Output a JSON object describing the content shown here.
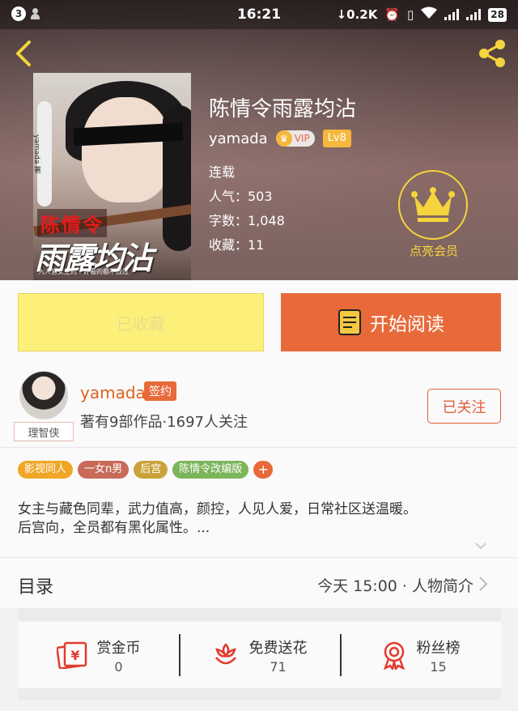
{
  "statusbar": {
    "badge": "3",
    "time": "16:21",
    "speed": "0.2K",
    "battery": "28"
  },
  "book": {
    "title": "陈情令雨露均沾",
    "author": "yamada",
    "vip": "VIP",
    "level": "Lv8",
    "status": "连载",
    "popularity": "人气：503",
    "words": "字数：1,048",
    "favorites": "收藏：11",
    "cover_title_line1": "陈情令",
    "cover_title_line2": "雨露均沾",
    "cover_author": "yamada",
    "cover_tag": "著",
    "cover_subtitle": "入人皆女主的｜好看的都不放过"
  },
  "member": {
    "label": "点亮会员"
  },
  "actions": {
    "collected_label": "已收藏",
    "read_label": "开始阅读"
  },
  "writer": {
    "name": "yamada",
    "sign_badge": "签约",
    "stats": "著有9部作品·1697人关注",
    "avatar_badge": "理智侠",
    "follow_label": "已关注"
  },
  "tags": [
    {
      "label": "影视同人",
      "color": "#f0a626"
    },
    {
      "label": "一女n男",
      "color": "#c96a58"
    },
    {
      "label": "后宫",
      "color": "#c9a23a"
    },
    {
      "label": "陈情令改编版",
      "color": "#7cb55a"
    }
  ],
  "tag_more": "+",
  "description": {
    "line1": "女主与藏色同辈，武力值高，颜控，人见人爱，日常社区送温暖。",
    "line2": "后宫向，全员都有黑化属性。..."
  },
  "toc": {
    "label": "目录",
    "latest": "今天 15:00 · 人物简介"
  },
  "stats": [
    {
      "label": "赏金币",
      "value": "0",
      "icon": "coin-envelope-icon"
    },
    {
      "label": "免费送花",
      "value": "71",
      "icon": "flower-icon"
    },
    {
      "label": "粉丝榜",
      "value": "15",
      "icon": "medal-icon"
    }
  ],
  "colors": {
    "accent": "#e86a3a",
    "gold": "#f5d43e",
    "collected_bg": "#fdf07a"
  }
}
